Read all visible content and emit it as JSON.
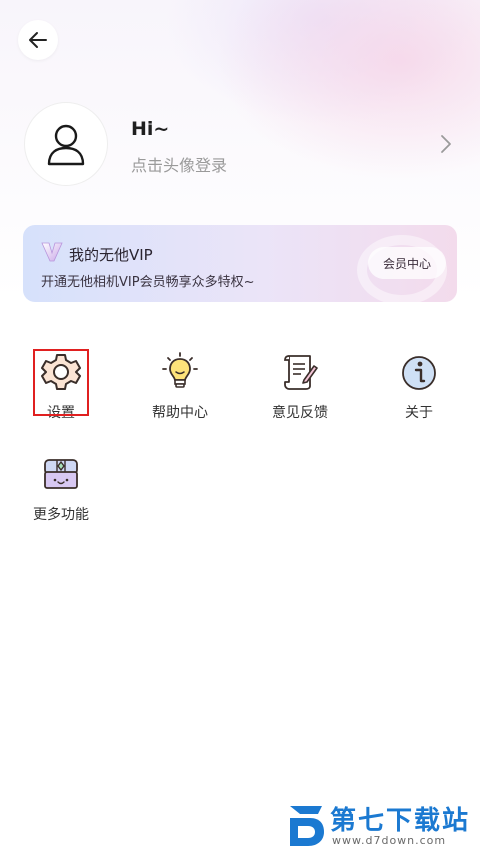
{
  "header": {
    "back_icon": "arrow-left-icon"
  },
  "profile": {
    "greeting": "Hi~",
    "login_hint": "点击头像登录",
    "avatar_icon": "user-icon",
    "chevron_icon": "chevron-right-icon"
  },
  "vip": {
    "title": "我的无他VIP",
    "description": "开通无他相机VIP会员畅享众多特权~",
    "button_label": "会员中心",
    "logo_icon": "vip-v-icon"
  },
  "menu": {
    "items": [
      {
        "label": "设置",
        "icon": "gear-icon"
      },
      {
        "label": "帮助中心",
        "icon": "lightbulb-icon"
      },
      {
        "label": "意见反馈",
        "icon": "scroll-pen-icon"
      },
      {
        "label": "关于",
        "icon": "info-icon"
      },
      {
        "label": "更多功能",
        "icon": "treasure-chest-icon"
      }
    ]
  },
  "watermark": {
    "title": "第七下载站",
    "url": "www.d7down.com"
  },
  "colors": {
    "accent_red": "#e02020",
    "watermark_blue": "#1b79d1",
    "hint_gray": "#9a9a9a"
  }
}
